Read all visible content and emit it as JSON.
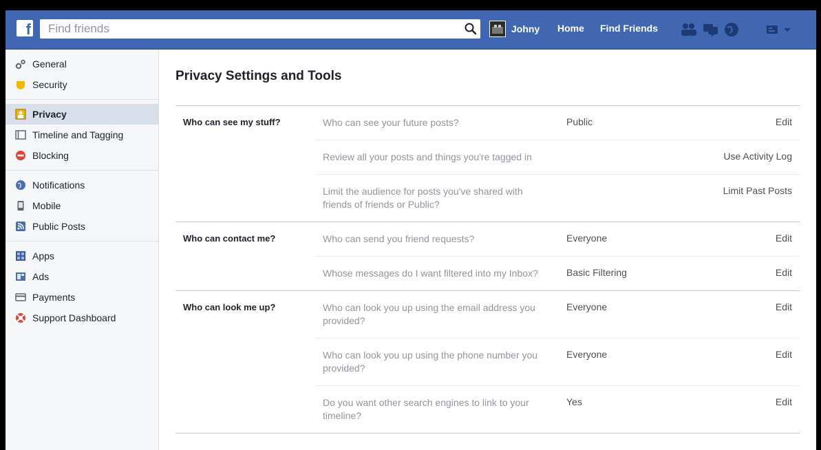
{
  "topbar": {
    "search_placeholder": "Find friends",
    "user_name": "Johny",
    "home_label": "Home",
    "find_friends_label": "Find Friends",
    "brand_color": "#4267b2"
  },
  "sidebar": {
    "items": [
      {
        "label": "General",
        "icon": "gears-icon"
      },
      {
        "label": "Security",
        "icon": "shield-icon"
      },
      {
        "label": "Privacy",
        "icon": "lock-icon",
        "selected": true
      },
      {
        "label": "Timeline and Tagging",
        "icon": "timeline-icon"
      },
      {
        "label": "Blocking",
        "icon": "block-icon"
      },
      {
        "label": "Notifications",
        "icon": "globe-icon"
      },
      {
        "label": "Mobile",
        "icon": "mobile-icon"
      },
      {
        "label": "Public Posts",
        "icon": "rss-icon"
      },
      {
        "label": "Apps",
        "icon": "apps-icon"
      },
      {
        "label": "Ads",
        "icon": "ads-icon"
      },
      {
        "label": "Payments",
        "icon": "credit-card-icon"
      },
      {
        "label": "Support Dashboard",
        "icon": "lifebuoy-icon"
      }
    ]
  },
  "main": {
    "title": "Privacy Settings and Tools",
    "sections": [
      {
        "title": "Who can see my stuff?",
        "rows": [
          {
            "question": "Who can see your future posts?",
            "value": "Public",
            "action": "Edit"
          },
          {
            "question": "Review all your posts and things you're tagged in",
            "value": "",
            "action": "Use Activity Log"
          },
          {
            "question": "Limit the audience for posts you've shared with friends of friends or Public?",
            "value": "",
            "action": "Limit Past Posts"
          }
        ]
      },
      {
        "title": "Who can contact me?",
        "rows": [
          {
            "question": "Who can send you friend requests?",
            "value": "Everyone",
            "action": "Edit"
          },
          {
            "question": "Whose messages do I want filtered into my Inbox?",
            "value": "Basic Filtering",
            "action": "Edit"
          }
        ]
      },
      {
        "title": "Who can look me up?",
        "rows": [
          {
            "question": "Who can look you up using the email address you provided?",
            "value": "Everyone",
            "action": "Edit"
          },
          {
            "question": "Who can look you up using the phone number you provided?",
            "value": "Everyone",
            "action": "Edit"
          },
          {
            "question": "Do you want other search engines to link to your timeline?",
            "value": "Yes",
            "action": "Edit"
          }
        ]
      }
    ]
  }
}
